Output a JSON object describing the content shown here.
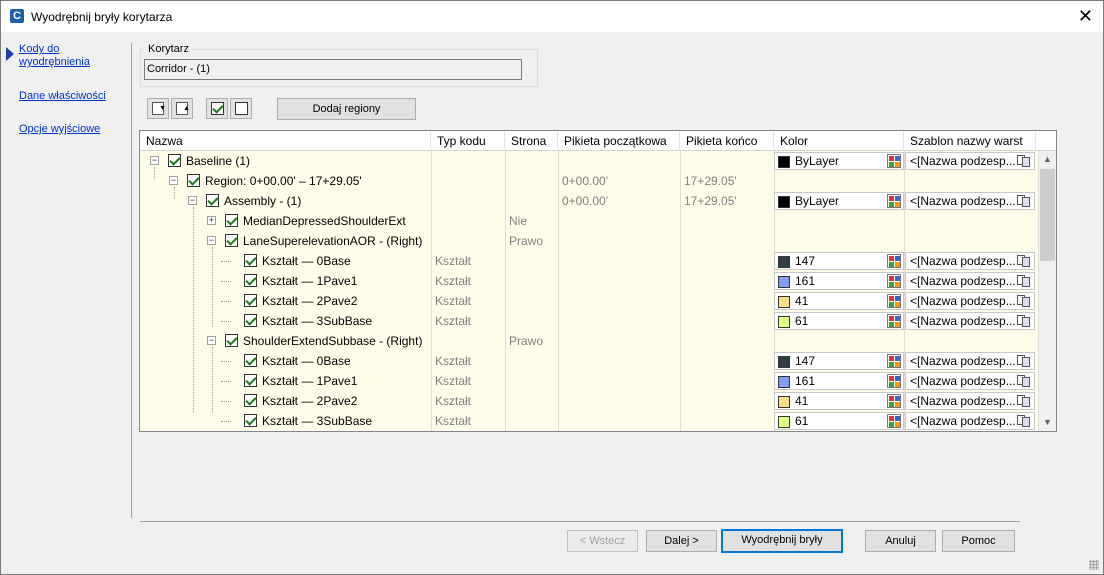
{
  "window": {
    "title": "Wyodrębnij bryły korytarza",
    "close_glyph": "✕"
  },
  "nav": {
    "items": [
      {
        "label": "Kody do wyodrębnienia",
        "active": true
      },
      {
        "label": "Dane właściwości",
        "active": false
      },
      {
        "label": "Opcje wyjściowe",
        "active": false
      }
    ]
  },
  "corridor": {
    "group_label": "Korytarz",
    "value": "Corridor - (1)"
  },
  "toolbar": {
    "add_regions_label": "Dodaj regiony"
  },
  "grid": {
    "columns": [
      "Nazwa",
      "Typ kodu",
      "Strona",
      "Pikieta początkowa",
      "Pikieta końco",
      "Kolor",
      "Szablon nazwy warst"
    ],
    "rows": [
      {
        "name": "Baseline (1)",
        "type": "",
        "side": "",
        "start": "",
        "end": "",
        "color": "ByLayer",
        "swatch": "#000000",
        "template": "<[Nazwa podzesp..."
      },
      {
        "name": "Region: 0+00.00' – 17+29.05'",
        "type": "",
        "side": "",
        "start": "0+00.00'",
        "end": "17+29.05'",
        "color": "",
        "swatch": "",
        "template": ""
      },
      {
        "name": "Assembly - (1)",
        "type": "",
        "side": "",
        "start": "0+00.00'",
        "end": "17+29.05'",
        "color": "ByLayer",
        "swatch": "#000000",
        "template": "<[Nazwa podzesp..."
      },
      {
        "name": "MedianDepressedShoulderExt",
        "type": "",
        "side": "Nie",
        "start": "",
        "end": "",
        "color": "",
        "swatch": "",
        "template": ""
      },
      {
        "name": "LaneSuperelevationAOR - (Right)",
        "type": "",
        "side": "Prawo",
        "start": "",
        "end": "",
        "color": "",
        "swatch": "",
        "template": ""
      },
      {
        "name": "Kształt — 0Base",
        "type": "Kształt",
        "side": "",
        "start": "",
        "end": "",
        "color": "147",
        "swatch": "#2f3f46",
        "template": "<[Nazwa podzesp..."
      },
      {
        "name": "Kształt — 1Pave1",
        "type": "Kształt",
        "side": "",
        "start": "",
        "end": "",
        "color": "161",
        "swatch": "#7f9fff",
        "template": "<[Nazwa podzesp..."
      },
      {
        "name": "Kształt — 2Pave2",
        "type": "Kształt",
        "side": "",
        "start": "",
        "end": "",
        "color": "41",
        "swatch": "#ffdf7f",
        "template": "<[Nazwa podzesp..."
      },
      {
        "name": "Kształt — 3SubBase",
        "type": "Kształt",
        "side": "",
        "start": "",
        "end": "",
        "color": "61",
        "swatch": "#dfff7f",
        "template": "<[Nazwa podzesp..."
      },
      {
        "name": "ShoulderExtendSubbase - (Right)",
        "type": "",
        "side": "Prawo",
        "start": "",
        "end": "",
        "color": "",
        "swatch": "",
        "template": ""
      },
      {
        "name": "Kształt — 0Base",
        "type": "Kształt",
        "side": "",
        "start": "",
        "end": "",
        "color": "147",
        "swatch": "#2f3f46",
        "template": "<[Nazwa podzesp..."
      },
      {
        "name": "Kształt — 1Pave1",
        "type": "Kształt",
        "side": "",
        "start": "",
        "end": "",
        "color": "161",
        "swatch": "#7f9fff",
        "template": "<[Nazwa podzesp..."
      },
      {
        "name": "Kształt — 2Pave2",
        "type": "Kształt",
        "side": "",
        "start": "",
        "end": "",
        "color": "41",
        "swatch": "#ffdf7f",
        "template": "<[Nazwa podzesp..."
      },
      {
        "name": "Kształt — 3SubBase",
        "type": "Kształt",
        "side": "",
        "start": "",
        "end": "",
        "color": "61",
        "swatch": "#dfff7f",
        "template": "<[Nazwa podzesp..."
      }
    ]
  },
  "footer": {
    "back_label": "< Wstecz",
    "next_label": "Dalej >",
    "extract_label": "Wyodrębnij bryły",
    "cancel_label": "Anuluj",
    "help_label": "Pomoc"
  }
}
